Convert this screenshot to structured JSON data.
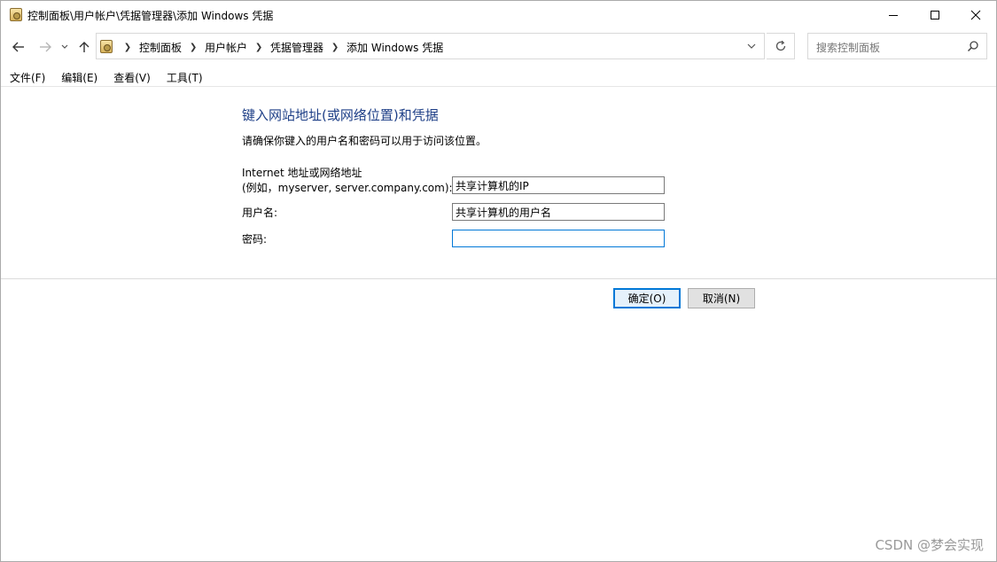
{
  "window": {
    "title": "控制面板\\用户帐户\\凭据管理器\\添加 Windows 凭据"
  },
  "address": {
    "crumbs": [
      "控制面板",
      "用户帐户",
      "凭据管理器",
      "添加 Windows 凭据"
    ]
  },
  "search": {
    "placeholder": "搜索控制面板"
  },
  "menu": {
    "items": [
      "文件(F)",
      "编辑(E)",
      "查看(V)",
      "工具(T)"
    ]
  },
  "form": {
    "heading": "键入网站地址(或网络位置)和凭据",
    "description": "请确保你键入的用户名和密码可以用于访问该位置。",
    "address_label_line1": "Internet 地址或网络地址",
    "address_label_line2": "(例如，myserver, server.company.com):",
    "address_value": "共享计算机的IP",
    "username_label": "用户名:",
    "username_value": "共享计算机的用户名",
    "password_label": "密码:",
    "password_value": ""
  },
  "buttons": {
    "ok": "确定(O)",
    "cancel": "取消(N)"
  },
  "watermark": "CSDN @梦会实现",
  "colors": {
    "heading": "#1e3f87",
    "accent": "#0078d7"
  }
}
